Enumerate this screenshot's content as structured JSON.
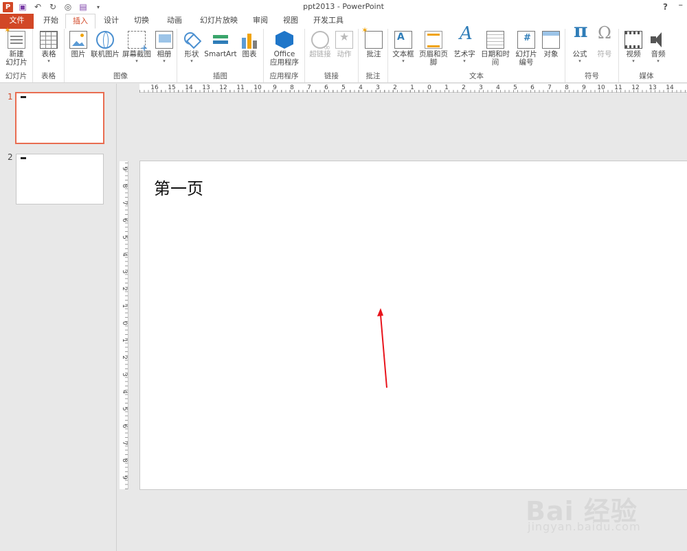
{
  "app": {
    "window_title": "ppt2013 - PowerPoint",
    "help": "?",
    "minimize": "–"
  },
  "qat": {
    "logo": "P",
    "icons": [
      "save-icon",
      "undo-icon",
      "redo-icon",
      "start-from-beginning-icon",
      "save-as-icon",
      "customize-qat-icon"
    ]
  },
  "tabs": [
    {
      "label": "文件"
    },
    {
      "label": "开始"
    },
    {
      "label": "插入",
      "active": true
    },
    {
      "label": "设计"
    },
    {
      "label": "切换"
    },
    {
      "label": "动画"
    },
    {
      "label": "幻灯片放映"
    },
    {
      "label": "审阅"
    },
    {
      "label": "视图"
    },
    {
      "label": "开发工具"
    }
  ],
  "ribbon": {
    "groups": {
      "slides": "幻灯片",
      "tables": "表格",
      "images": "图像",
      "illustrations": "插图",
      "apps": "应用程序",
      "links": "链接",
      "comments": "批注",
      "text": "文本",
      "symbols": "符号",
      "media": "媒体"
    },
    "buttons": {
      "new_slide_1": "新建",
      "new_slide_2": "幻灯片",
      "table": "表格",
      "picture": "图片",
      "online_picture": "联机图片",
      "screenshot": "屏幕截图",
      "album": "相册",
      "shapes": "形状",
      "smartart": "SmartArt",
      "chart": "图表",
      "office_apps_1": "Office",
      "office_apps_2": "应用程序",
      "hyperlink": "超链接",
      "action": "动作",
      "comment": "批注",
      "textbox": "文本框",
      "header_footer": "页眉和页脚",
      "wordart": "艺术字",
      "date_time": "日期和时间",
      "slide_number_1": "幻灯片",
      "slide_number_2": "编号",
      "object": "对象",
      "equation": "公式",
      "symbol": "符号",
      "video": "视频",
      "audio": "音频"
    }
  },
  "thumbnails": [
    {
      "number": "1",
      "selected": true
    },
    {
      "number": "2",
      "selected": false
    }
  ],
  "rulers": {
    "horizontal": [
      "16",
      "15",
      "14",
      "13",
      "12",
      "11",
      "10",
      "9",
      "8",
      "7",
      "6",
      "5",
      "4",
      "3",
      "2",
      "1",
      "0",
      "1",
      "2",
      "3",
      "4",
      "5",
      "6",
      "7",
      "8",
      "9",
      "10",
      "11",
      "12",
      "13",
      "14"
    ],
    "vertical": [
      "9",
      "8",
      "7",
      "6",
      "5",
      "4",
      "3",
      "2",
      "1",
      "0",
      "1",
      "2",
      "3",
      "4",
      "5",
      "6",
      "7",
      "8",
      "9"
    ]
  },
  "slide": {
    "title": "第一页"
  },
  "annotation": {
    "arrow_color": "#e8141c"
  },
  "watermark": {
    "brand": "Bai 经验",
    "url": "jingyan.baidu.com"
  },
  "colors": {
    "accent": "#d24726",
    "selected_thumb_border": "#e96d51"
  }
}
